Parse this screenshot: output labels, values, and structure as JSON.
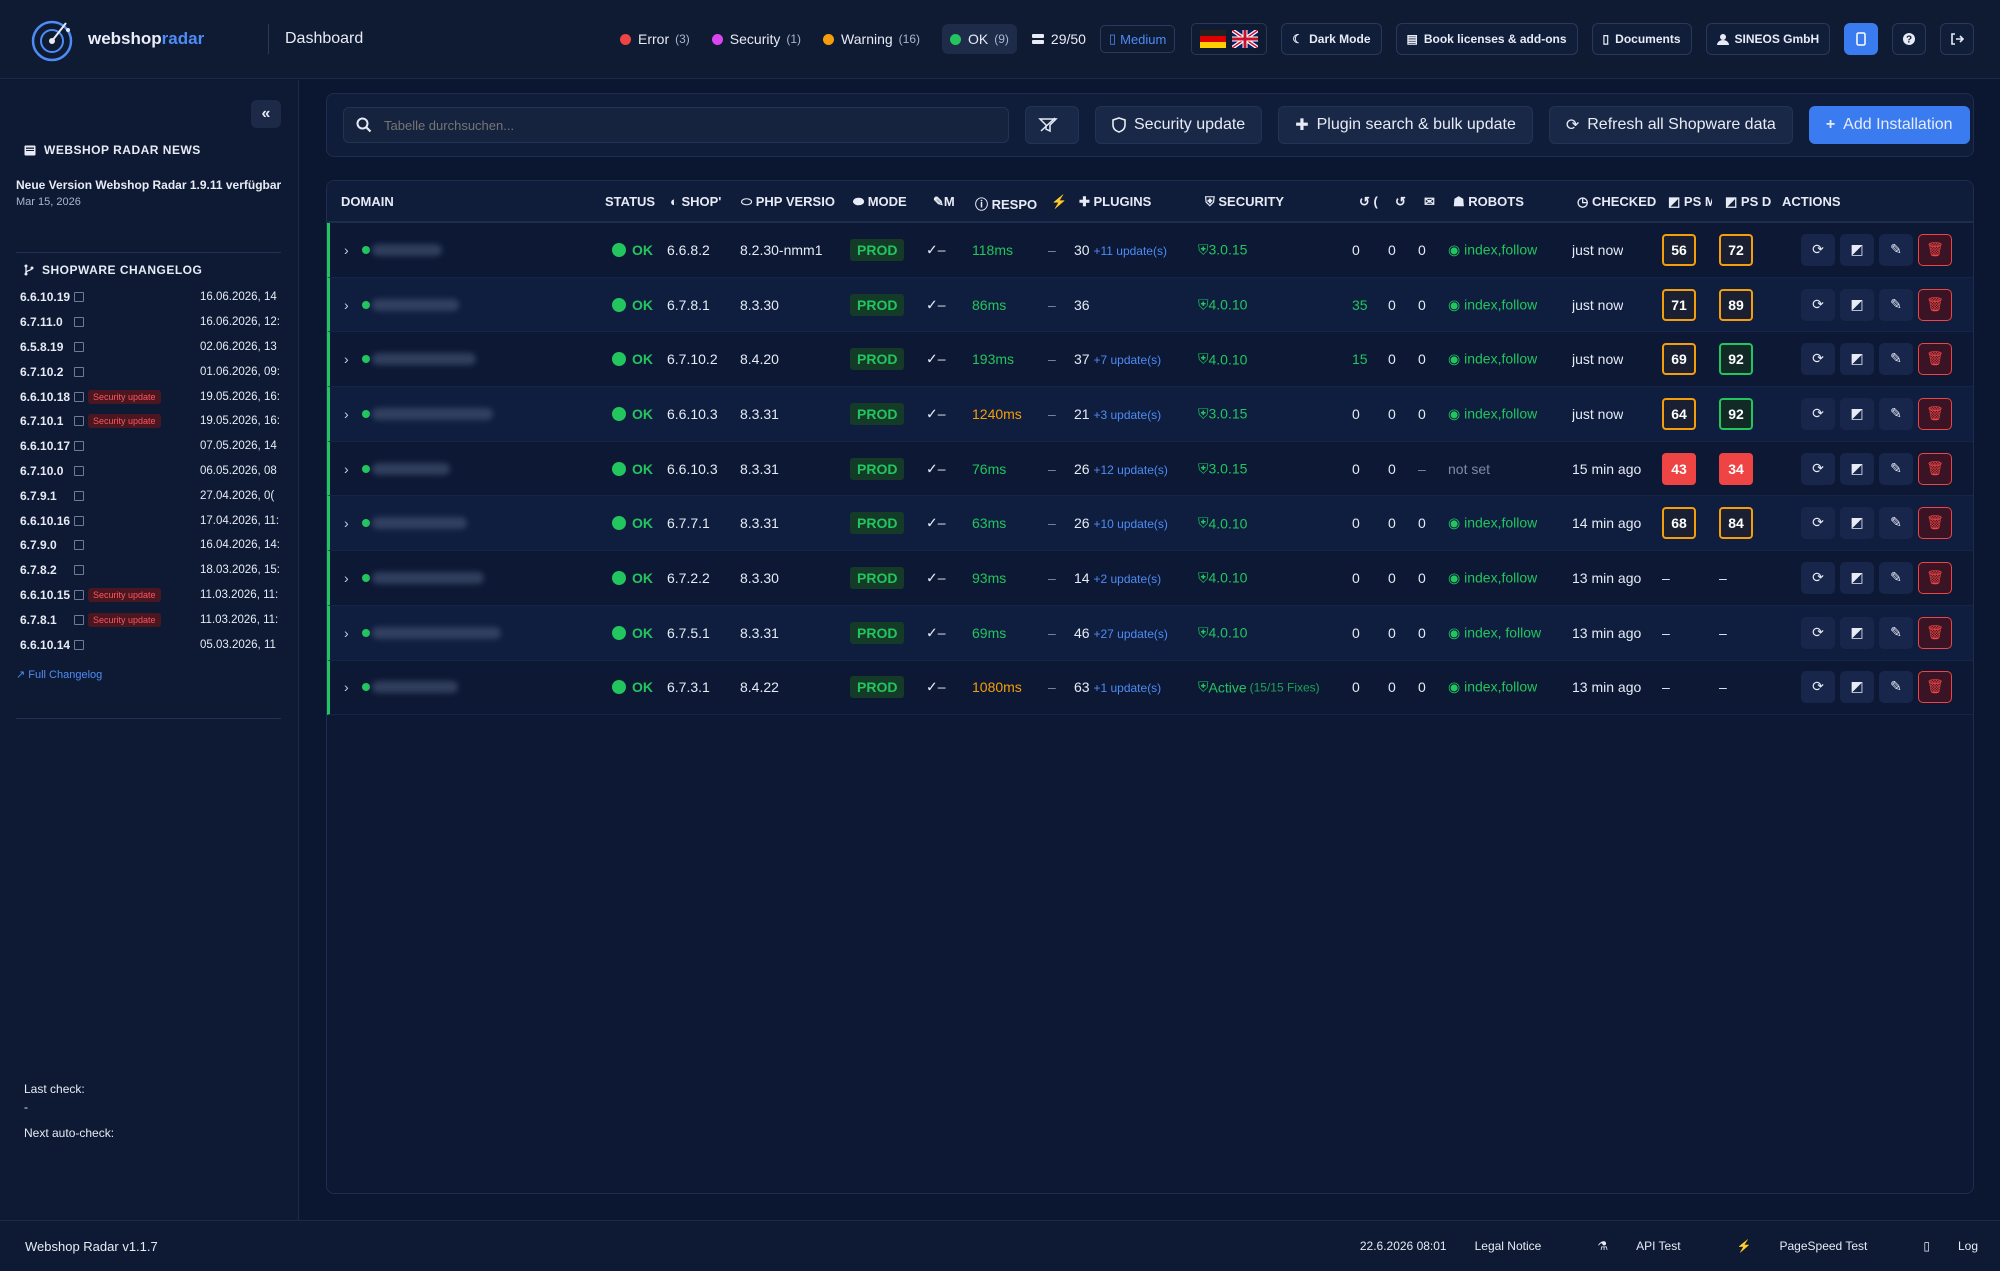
{
  "brand": {
    "name_a": "webshop",
    "name_b": "radar"
  },
  "topbar": {
    "page_title": "Dashboard",
    "statuses": [
      {
        "label": "Error",
        "count": "(3)",
        "color": "#ef4444"
      },
      {
        "label": "Security",
        "count": "(1)",
        "color": "#d946ef"
      },
      {
        "label": "Warning",
        "count": "(16)",
        "color": "#f59e0b"
      },
      {
        "label": "OK",
        "count": "(9)",
        "color": "#22c55e"
      }
    ],
    "licenses": "29/50",
    "plan": "Medium",
    "dark_mode": "Dark Mode",
    "book": "Book licenses & add-ons",
    "documents": "Documents",
    "company": "SINEOS GmbH"
  },
  "sidebar": {
    "news_heading": "WEBSHOP RADAR NEWS",
    "news_title": "Neue Version Webshop Radar 1.9.11 verfügbar",
    "news_date": "Mar 15, 2026",
    "changelog_heading": "SHOPWARE CHANGELOG",
    "changelog": [
      {
        "version": "6.6.10.19",
        "badge": "",
        "date": "16.06.2026, 14"
      },
      {
        "version": "6.7.11.0",
        "badge": "",
        "date": "16.06.2026, 12:"
      },
      {
        "version": "6.5.8.19",
        "badge": "",
        "date": "02.06.2026, 13"
      },
      {
        "version": "6.7.10.2",
        "badge": "",
        "date": "01.06.2026, 09:"
      },
      {
        "version": "6.6.10.18",
        "badge": "Security update",
        "date": "19.05.2026, 16:"
      },
      {
        "version": "6.7.10.1",
        "badge": "Security update",
        "date": "19.05.2026, 16:"
      },
      {
        "version": "6.6.10.17",
        "badge": "",
        "date": "07.05.2026, 14"
      },
      {
        "version": "6.7.10.0",
        "badge": "",
        "date": "06.05.2026, 08"
      },
      {
        "version": "6.7.9.1",
        "badge": "",
        "date": "27.04.2026, 0("
      },
      {
        "version": "6.6.10.16",
        "badge": "",
        "date": "17.04.2026, 11:"
      },
      {
        "version": "6.7.9.0",
        "badge": "",
        "date": "16.04.2026, 14:"
      },
      {
        "version": "6.7.8.2",
        "badge": "",
        "date": "18.03.2026, 15:"
      },
      {
        "version": "6.6.10.15",
        "badge": "Security update",
        "date": "11.03.2026, 11:"
      },
      {
        "version": "6.7.8.1",
        "badge": "Security update",
        "date": "11.03.2026, 11:"
      },
      {
        "version": "6.6.10.14",
        "badge": "",
        "date": "05.03.2026, 11"
      }
    ],
    "full_changelog": "Full Changelog",
    "last_check_label": "Last check:",
    "last_check_value": "-",
    "next_check_label": "Next auto-check:"
  },
  "toolbar": {
    "search_placeholder": "Tabelle durchsuchen...",
    "security_update": "Security update",
    "plugin_search": "Plugin search & bulk update",
    "refresh": "Refresh all Shopware data",
    "add": "Add Installation"
  },
  "table": {
    "headers": {
      "domain": "DOMAIN",
      "status": "STATUS",
      "shop": "SHOP'",
      "php": "PHP VERSIO",
      "mode": "MODE",
      "m": "M",
      "resp": "RESPO",
      "plugins": "PLUGINS",
      "security": "SECURITY",
      "robots": "ROBOTS",
      "checked": "CHECKED",
      "psm": "PS M",
      "psd": "PS D",
      "actions": "ACTIONS"
    },
    "rows": [
      {
        "status": "OK",
        "shop": "6.6.8.2",
        "php": "8.2.30-nmm1",
        "mode": "PROD",
        "m": "✓–",
        "resp": "118ms",
        "resp_color": "green",
        "dash": "–",
        "plugins": "30",
        "updates": "+11 update(s)",
        "security": "3.0.15",
        "sec_sub": "",
        "c1": "0",
        "c2": "0",
        "c3": "0",
        "robots": "index,follow",
        "checked": "just now",
        "psm": "56",
        "psm_c": "o",
        "psd": "72",
        "psd_c": "o"
      },
      {
        "status": "OK",
        "shop": "6.7.8.1",
        "php": "8.3.30",
        "mode": "PROD",
        "m": "✓–",
        "resp": "86ms",
        "resp_color": "green",
        "dash": "–",
        "plugins": "36",
        "updates": "",
        "security": "4.0.10",
        "sec_sub": "",
        "c1": "35",
        "c2": "0",
        "c3": "0",
        "robots": "index,follow",
        "checked": "just now",
        "psm": "71",
        "psm_c": "o",
        "psd": "89",
        "psd_c": "o"
      },
      {
        "status": "OK",
        "shop": "6.7.10.2",
        "php": "8.4.20",
        "mode": "PROD",
        "m": "✓–",
        "resp": "193ms",
        "resp_color": "green",
        "dash": "–",
        "plugins": "37",
        "updates": "+7 update(s)",
        "security": "4.0.10",
        "sec_sub": "",
        "c1": "15",
        "c2": "0",
        "c3": "0",
        "robots": "index,follow",
        "checked": "just now",
        "psm": "69",
        "psm_c": "o",
        "psd": "92",
        "psd_c": "g"
      },
      {
        "status": "OK",
        "shop": "6.6.10.3",
        "php": "8.3.31",
        "mode": "PROD",
        "m": "✓–",
        "resp": "1240ms",
        "resp_color": "orange",
        "dash": "–",
        "plugins": "21",
        "updates": "+3 update(s)",
        "security": "3.0.15",
        "sec_sub": "",
        "c1": "0",
        "c2": "0",
        "c3": "0",
        "robots": "index,follow",
        "checked": "just now",
        "psm": "64",
        "psm_c": "o",
        "psd": "92",
        "psd_c": "g"
      },
      {
        "status": "OK",
        "shop": "6.6.10.3",
        "php": "8.3.31",
        "mode": "PROD",
        "m": "✓–",
        "resp": "76ms",
        "resp_color": "green",
        "dash": "–",
        "plugins": "26",
        "updates": "+12 update(s)",
        "security": "3.0.15",
        "sec_sub": "",
        "c1": "0",
        "c2": "0",
        "c3": "–",
        "robots": "not set",
        "checked": "15 min ago",
        "psm": "43",
        "psm_c": "r",
        "psd": "34",
        "psd_c": "r"
      },
      {
        "status": "OK",
        "shop": "6.7.7.1",
        "php": "8.3.31",
        "mode": "PROD",
        "m": "✓–",
        "resp": "63ms",
        "resp_color": "green",
        "dash": "–",
        "plugins": "26",
        "updates": "+10 update(s)",
        "security": "4.0.10",
        "sec_sub": "",
        "c1": "0",
        "c2": "0",
        "c3": "0",
        "robots": "index,follow",
        "checked": "14 min ago",
        "psm": "68",
        "psm_c": "o",
        "psd": "84",
        "psd_c": "o"
      },
      {
        "status": "OK",
        "shop": "6.7.2.2",
        "php": "8.3.30",
        "mode": "PROD",
        "m": "✓–",
        "resp": "93ms",
        "resp_color": "green",
        "dash": "–",
        "plugins": "14",
        "updates": "+2 update(s)",
        "security": "4.0.10",
        "sec_sub": "",
        "c1": "0",
        "c2": "0",
        "c3": "0",
        "robots": "index,follow",
        "checked": "13 min ago",
        "psm": "–",
        "psm_c": "",
        "psd": "–",
        "psd_c": ""
      },
      {
        "status": "OK",
        "shop": "6.7.5.1",
        "php": "8.3.31",
        "mode": "PROD",
        "m": "✓–",
        "resp": "69ms",
        "resp_color": "green",
        "dash": "–",
        "plugins": "46",
        "updates": "+27 update(s)",
        "security": "4.0.10",
        "sec_sub": "",
        "c1": "0",
        "c2": "0",
        "c3": "0",
        "robots": "index, follow",
        "checked": "13 min ago",
        "psm": "–",
        "psm_c": "",
        "psd": "–",
        "psd_c": ""
      },
      {
        "status": "OK",
        "shop": "6.7.3.1",
        "php": "8.4.22",
        "mode": "PROD",
        "m": "✓–",
        "resp": "1080ms",
        "resp_color": "orange",
        "dash": "–",
        "plugins": "63",
        "updates": "+1 update(s)",
        "security": "Active",
        "sec_sub": "(15/15 Fixes)",
        "c1": "0",
        "c2": "0",
        "c3": "0",
        "robots": "index,follow",
        "checked": "13 min ago",
        "psm": "–",
        "psm_c": "",
        "psd": "–",
        "psd_c": ""
      }
    ]
  },
  "footer": {
    "version": "Webshop Radar v1.1.7",
    "datetime": "22.6.2026 08:01",
    "legal": "Legal Notice",
    "api": "API Test",
    "pagespeed": "PageSpeed Test",
    "log": "Log"
  }
}
